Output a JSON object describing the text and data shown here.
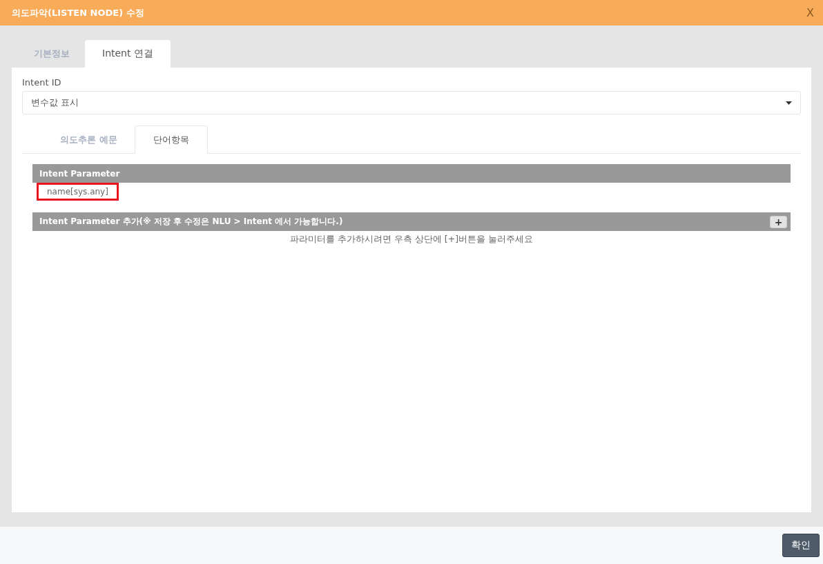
{
  "dialog": {
    "title": "의도파악(LISTEN NODE) 수정",
    "close": "X"
  },
  "tabs": [
    {
      "label": "기본정보",
      "selected": false
    },
    {
      "label": "Intent 연결",
      "selected": true
    }
  ],
  "intent_id": {
    "label": "Intent ID",
    "value": "변수값 표시"
  },
  "sub_tabs": [
    {
      "label": "의도추론 예문",
      "selected": false
    },
    {
      "label": "단어항목",
      "selected": true
    }
  ],
  "parameter_section": {
    "title": "Intent Parameter",
    "items": [
      {
        "label": "name[sys.any]",
        "selected": true
      }
    ]
  },
  "add_section": {
    "title": "Intent Parameter 추가(※ 저장 후 수정은 NLU > Intent 에서 가능합니다.)",
    "add_button": "+",
    "hint": "파라미터를 추가하시려면 우측 상단에 [+]버튼을 눌러주세요"
  },
  "footer": {
    "buttons": [
      "확인"
    ]
  }
}
